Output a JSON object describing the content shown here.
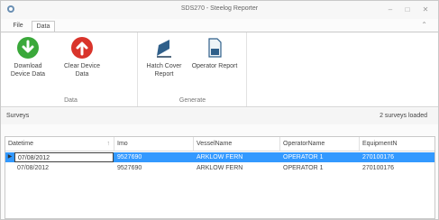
{
  "window": {
    "title": "SDS270 - Steelog Reporter",
    "controls": {
      "minimize": "–",
      "maximize": "□",
      "close": "✕"
    }
  },
  "tabs": [
    {
      "label": "File",
      "active": false
    },
    {
      "label": "Data",
      "active": true
    }
  ],
  "ribbon": {
    "groups": [
      {
        "label": "Data",
        "buttons": [
          {
            "label": "Download Device Data",
            "icon": "green-download-icon",
            "color": "#3aa83a"
          },
          {
            "label": "Clear Device Data",
            "icon": "red-clear-icon",
            "color": "#d9342b"
          }
        ]
      },
      {
        "label": "Generate",
        "buttons": [
          {
            "label": "Hatch Cover Report",
            "icon": "hatch-cover-report-icon",
            "color": "#2f5f8a"
          },
          {
            "label": "Operator Report",
            "icon": "operator-report-icon",
            "color": "#2f5f8a"
          }
        ]
      }
    ]
  },
  "surveys": {
    "title": "Surveys",
    "status": "2 surveys loaded"
  },
  "grid": {
    "columns": [
      "Datetime",
      "Imo",
      "VesselName",
      "OperatorName",
      "EquipmentN"
    ],
    "rows": [
      [
        "07/08/2012",
        "9527690",
        "ARKLOW FERN",
        "OPERATOR 1",
        "270100176"
      ],
      [
        "07/08/2012",
        "9527690",
        "ARKLOW FERN",
        "OPERATOR 1",
        "270100176"
      ]
    ],
    "selected_row": 0,
    "selection_color": "#3399ff"
  }
}
